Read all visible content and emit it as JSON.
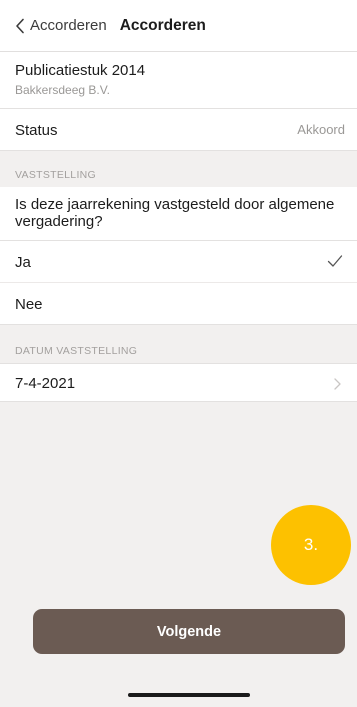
{
  "navbar": {
    "back_label": "Accorderen",
    "title": "Accorderen"
  },
  "document": {
    "title": "Publicatiestuk 2014",
    "company": "Bakkersdeeg B.V."
  },
  "status": {
    "label": "Status",
    "value": "Akkoord"
  },
  "vaststelling": {
    "header": "VASTSTELLING",
    "question": "Is deze jaarrekening vastgesteld door algemene vergadering?",
    "options": [
      {
        "label": "Ja",
        "selected": true
      },
      {
        "label": "Nee",
        "selected": false
      }
    ]
  },
  "datum": {
    "header": "DATUM VASTSTELLING",
    "value": "7-4-2021"
  },
  "step_badge": {
    "label": "3.",
    "color": "#fdc100"
  },
  "next_button": {
    "label": "Volgende",
    "color": "#6b5b53"
  }
}
